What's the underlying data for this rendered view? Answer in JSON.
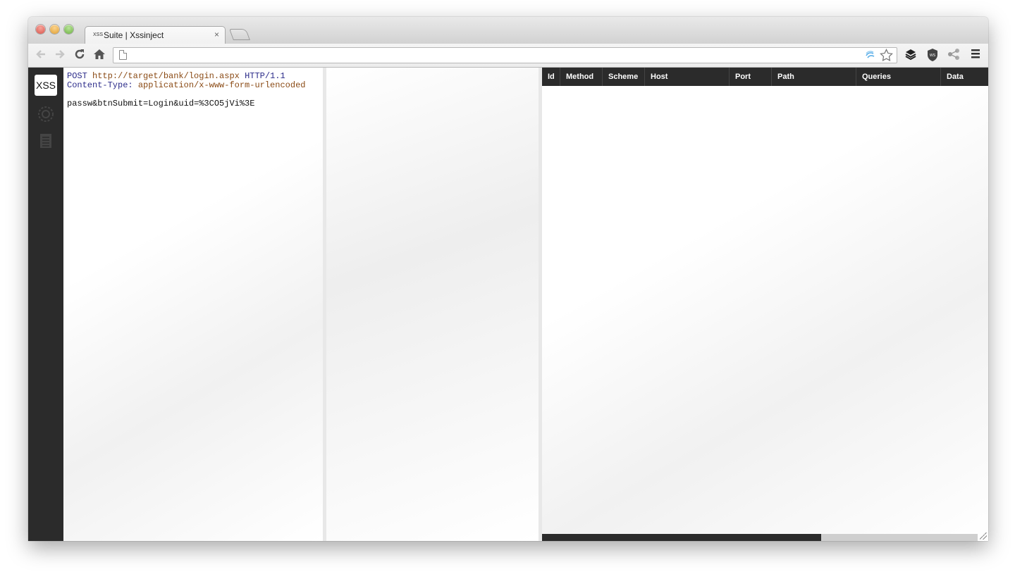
{
  "browser": {
    "tab_title": "Suite | Xssinject",
    "tab_favicon_text": "XSS",
    "tab_close_glyph": "×",
    "address_value": "",
    "icons": {
      "back": "back-arrow-icon",
      "forward": "forward-arrow-icon",
      "reload": "reload-icon",
      "home": "home-icon",
      "page": "page-icon",
      "extension_wave": "wave-icon",
      "bookmark": "star-icon",
      "extensions": [
        "layers-icon",
        "shield-icon",
        "share-icon"
      ],
      "menu": "menu-icon"
    },
    "shield_text": "WS"
  },
  "sidebar": {
    "logo_text": "XSS",
    "items": [
      {
        "name": "target-icon"
      },
      {
        "name": "report-icon"
      }
    ]
  },
  "request": {
    "method": "POST",
    "url": "http://target/bank/login.aspx",
    "version": "HTTP/1.1",
    "header_key": "Content-Type:",
    "header_value": "application/x-www-form-urlencoded",
    "body": "passw&btnSubmit=Login&uid=%3CO5jVi%3E"
  },
  "results": {
    "columns": [
      "Id",
      "Method",
      "Scheme",
      "Host",
      "Port",
      "Path",
      "Queries",
      "Data"
    ],
    "rows": [],
    "scroll_fraction": 0.64
  },
  "colors": {
    "sidebar_bg": "#2b2b2b",
    "table_header_bg": "#2b2b2b",
    "syntax_keyword": "#2c2c8a",
    "syntax_string": "#8a4a14"
  }
}
